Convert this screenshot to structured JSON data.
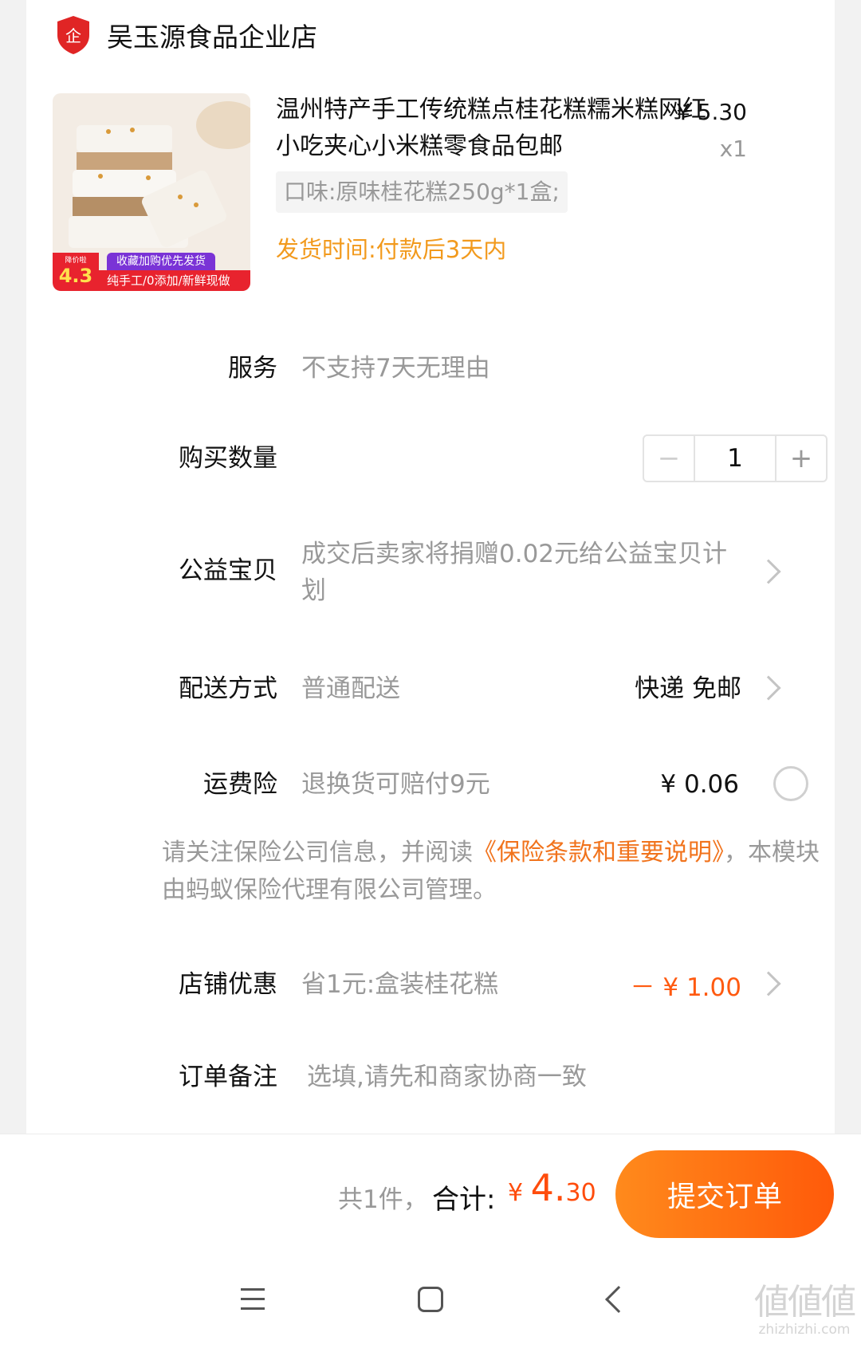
{
  "shop": {
    "name": "吴玉源食品企业店",
    "badge": "企",
    "badge_icon": "enterprise-shield-icon"
  },
  "product": {
    "title": "温州特产手工传统糕点桂花糕糯米糕网红小吃夹心小米糕零食品包邮",
    "unit_price": "¥ 5.30",
    "quantity_text": "x1",
    "sku": "口味:原味桂花糕250g*1盒;",
    "ship_time": "发货时间:付款后3天内",
    "thumbnail": {
      "rate_label": "降价啦",
      "rate_value": "4.3",
      "top_tag": "收藏加购优先发货",
      "bottom_tag": "纯手工/0添加/新鲜现做"
    }
  },
  "rows": {
    "service": {
      "label": "服务",
      "value": "不支持7天无理由"
    },
    "quantity": {
      "label": "购买数量",
      "value": "1",
      "minus": "−",
      "plus": "+"
    },
    "charity": {
      "label": "公益宝贝",
      "value_line1": "成交后卖家将捐赠0.02元给公益宝贝计",
      "value_line2": "划"
    },
    "delivery": {
      "label": "配送方式",
      "value": "普通配送",
      "right": "快递 免邮"
    },
    "insurance": {
      "label": "运费险",
      "value": "退换货可赔付9元",
      "price": "¥ 0.06"
    },
    "notice": {
      "prefix": "请关注保险公司信息，并阅读",
      "link": "《保险条款和重要说明》",
      "suffix": "，本模块由蚂蚁保险代理有限公司管理。"
    },
    "shop_discount": {
      "label": "店铺优惠",
      "value": "省1元:盒装桂花糕",
      "amount": "－ ¥ 1.00"
    },
    "remark": {
      "label": "订单备注",
      "placeholder": "选填,请先和商家协商一致"
    }
  },
  "footer": {
    "count": "共1件，",
    "total_label": "合计:",
    "currency": "¥",
    "total_int": "4.",
    "total_dec": "30",
    "submit": "提交订单"
  },
  "watermark": {
    "logo": "値値値",
    "url": "zhizhizhi.com"
  },
  "colors": {
    "accent": "#ff5a0a",
    "ship_time": "#f29a1d",
    "link": "#f1731c"
  }
}
